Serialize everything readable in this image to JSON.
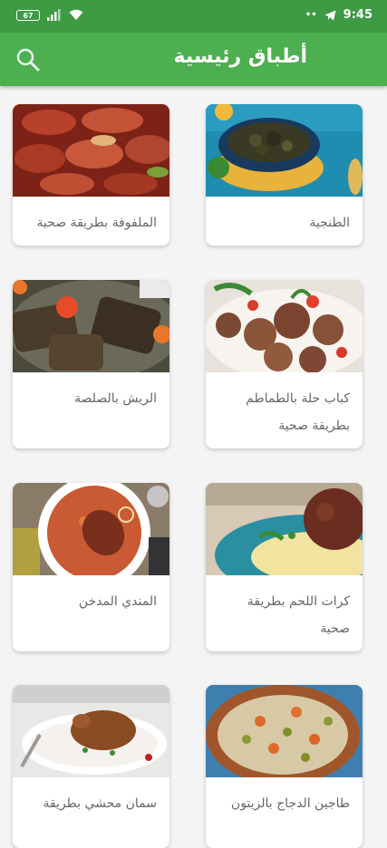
{
  "status_bar": {
    "battery": "67",
    "time": "9:45",
    "dots": "••"
  },
  "app_bar": {
    "title": "أطباق رئيسية"
  },
  "recipes": [
    {
      "title": "الطنجية"
    },
    {
      "title": "الملفوفة بطريقة صحية"
    },
    {
      "title": "كباب حلة بالطماطم بطريقة صحية"
    },
    {
      "title": "الريش بالصلصة"
    },
    {
      "title": "كرات اللحم بطريقة صحية"
    },
    {
      "title": "المندي المدخن"
    },
    {
      "title": "طاجين الدجاج بالزيتون"
    },
    {
      "title": "سمان محشي بطريقة"
    }
  ]
}
